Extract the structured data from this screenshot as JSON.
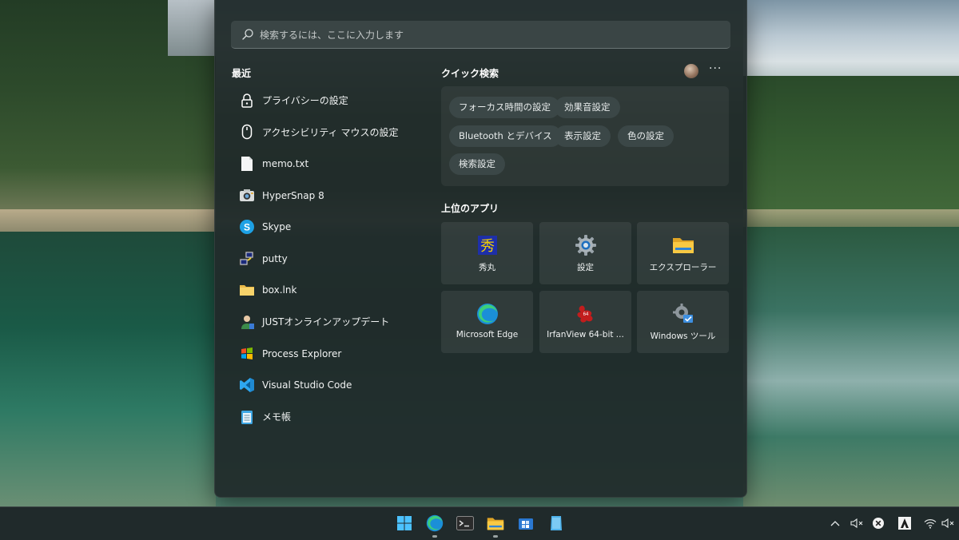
{
  "search": {
    "placeholder": "検索するには、ここに入力します"
  },
  "recent": {
    "title": "最近",
    "items": [
      {
        "label": "プライバシーの設定",
        "icon": "lock-icon"
      },
      {
        "label": "アクセシビリティ マウスの設定",
        "icon": "mouse-icon"
      },
      {
        "label": "memo.txt",
        "icon": "text-file-icon"
      },
      {
        "label": "HyperSnap 8",
        "icon": "hypersnap-icon"
      },
      {
        "label": "Skype",
        "icon": "skype-icon"
      },
      {
        "label": "putty",
        "icon": "putty-icon"
      },
      {
        "label": "box.lnk",
        "icon": "folder-shortcut-icon"
      },
      {
        "label": "JUSTオンラインアップデート",
        "icon": "just-update-icon"
      },
      {
        "label": "Process Explorer",
        "icon": "process-explorer-icon"
      },
      {
        "label": "Visual Studio Code",
        "icon": "vscode-icon"
      },
      {
        "label": "メモ帳",
        "icon": "notepad-icon"
      }
    ]
  },
  "quick_search": {
    "title": "クイック検索",
    "chips": [
      "フォーカス時間の設定",
      "効果音設定",
      "Bluetooth とデバイス",
      "表示設定",
      "色の設定",
      "検索設定"
    ],
    "more_label": "···"
  },
  "top_apps": {
    "title": "上位のアプリ",
    "tiles": [
      {
        "label": "秀丸",
        "icon": "hidemaru-icon"
      },
      {
        "label": "設定",
        "icon": "settings-gear-icon"
      },
      {
        "label": "エクスプローラー",
        "icon": "file-explorer-icon"
      },
      {
        "label": "Microsoft Edge",
        "icon": "edge-icon"
      },
      {
        "label": "IrfanView 64-bit ...",
        "icon": "irfanview-icon"
      },
      {
        "label": "Windows ツール",
        "icon": "windows-tools-icon"
      }
    ]
  },
  "taskbar": {
    "apps": [
      "windows-start-icon",
      "edge-icon",
      "terminal-icon",
      "file-explorer-icon",
      "store-icon",
      "notepad-icon"
    ],
    "tray": [
      "chevron-up-icon",
      "speaker-muted-icon",
      "close-circle-icon",
      "adobe-icon",
      "wifi-icon",
      "speaker-muted-icon"
    ]
  },
  "colors": {
    "panel": "#202a2a",
    "accent_blue": "#0a84d0"
  }
}
